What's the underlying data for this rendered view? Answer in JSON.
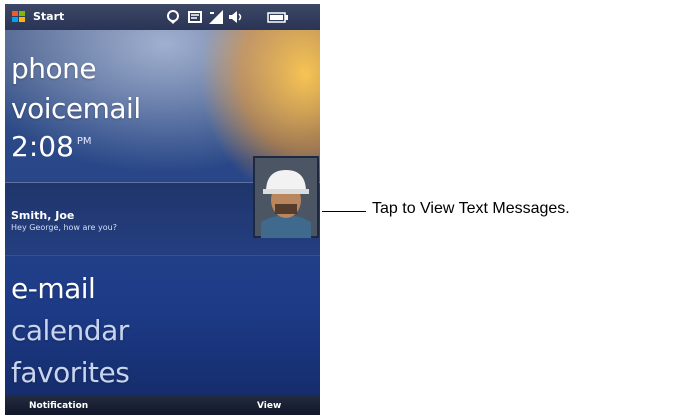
{
  "status_bar": {
    "start_label": "Start",
    "icons": [
      "sync-icon",
      "message-icon",
      "signal-icon",
      "volume-icon",
      "battery-icon"
    ]
  },
  "tiles": {
    "top": [
      "phone",
      "voicemail"
    ],
    "bottom": [
      "e-mail",
      "calendar",
      "favorites"
    ]
  },
  "clock": {
    "time": "2:08",
    "ampm": "PM"
  },
  "notification": {
    "sender": "Smith, Joe",
    "preview": "Hey George, how are you?"
  },
  "softkeys": {
    "left": "Notification",
    "right": "View"
  },
  "callout": {
    "text": "Tap to View Text Messages."
  },
  "colors": {
    "accent_orange": "#ffb440",
    "background_blue": "#24418a"
  }
}
